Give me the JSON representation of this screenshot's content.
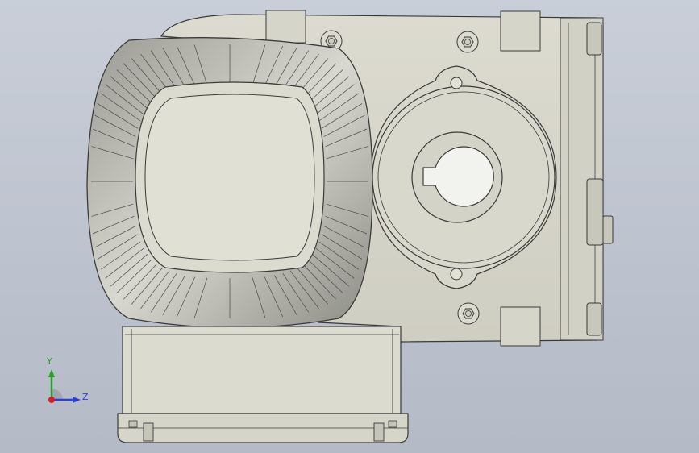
{
  "app": {
    "view_type": "cad-front-view",
    "part": "gear-motor-housing"
  },
  "colors": {
    "background_top": "#c9ced8",
    "background_bottom": "#b4bac6",
    "part_fill": "#d9d8cc",
    "part_fill_dark": "#c8c7bb",
    "edge": "#3a3a3a",
    "fin_dark": "#8a8a85",
    "fin_light": "#e6e6df",
    "axis_y": "#2a9e2a",
    "axis_z": "#2a3fd6",
    "axis_x": "#d42020"
  },
  "triad": {
    "y_label": "Y",
    "z_label": "Z"
  },
  "icons": [
    "triad-icon",
    "hex-bolt-icon"
  ]
}
